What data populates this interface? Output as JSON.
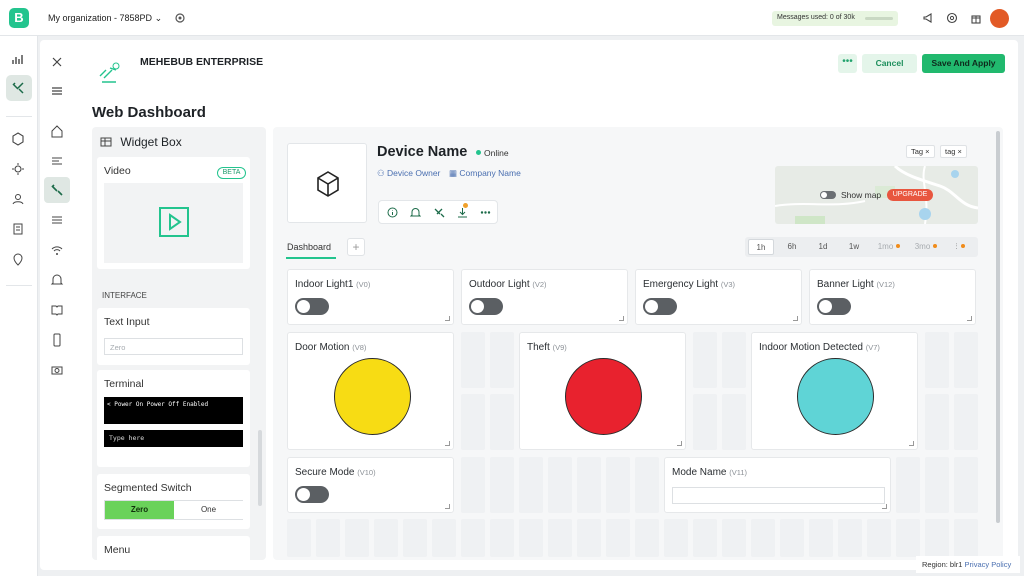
{
  "topbar": {
    "logo": "B",
    "org_name": "My organization - 7858PD",
    "messages": "Messages used: 0 of 30k",
    "icons": [
      "megaphone-icon",
      "globe-icon",
      "gift-icon"
    ],
    "avatar": "avatar"
  },
  "rail": {
    "items": [
      "dashboard-chart-icon",
      "devices-tools-icon",
      "cube-icon",
      "automation-icon",
      "users-icon",
      "organization-icon",
      "location-icon"
    ]
  },
  "header": {
    "device_template": "MEHEBUB ENTERPRISE",
    "more_label": "•••",
    "cancel_label": "Cancel",
    "save_label": "Save And Apply",
    "page_title": "Web Dashboard"
  },
  "widget_box": {
    "title": "Widget Box",
    "video": {
      "label": "Video",
      "badge": "BETA"
    },
    "section_interface": "INTERFACE",
    "text_input": {
      "label": "Text Input",
      "placeholder": "Zero"
    },
    "terminal": {
      "label": "Terminal",
      "output": "< Power On Power Off Enabled",
      "input_placeholder": "Type here"
    },
    "segmented": {
      "label": "Segmented Switch",
      "option_on": "Zero",
      "option_off": "One"
    },
    "menu": {
      "label": "Menu"
    }
  },
  "device": {
    "name": "Device Name",
    "status": "Online",
    "owner": "Device Owner",
    "company": "Company Name",
    "tags": [
      "Tag ×",
      "tag ×"
    ],
    "show_map": "Show map",
    "upgrade": "UPGRADE"
  },
  "tabs": {
    "dashboard": "Dashboard",
    "add": "+"
  },
  "ranges": [
    "1h",
    "6h",
    "1d",
    "1w",
    "1mo",
    "3mo"
  ],
  "widgets": {
    "indoor_light": {
      "title": "Indoor Light1",
      "pin": "(V0)"
    },
    "outdoor_light": {
      "title": "Outdoor Light",
      "pin": "(V2)"
    },
    "emergency_light": {
      "title": "Emergency Light",
      "pin": "(V3)"
    },
    "banner_light": {
      "title": "Banner Light",
      "pin": "(V12)"
    },
    "door_motion": {
      "title": "Door Motion",
      "pin": "(V8)",
      "color": "#f7dc14"
    },
    "theft": {
      "title": "Theft",
      "pin": "(V9)",
      "color": "#e8222e"
    },
    "indoor_motion": {
      "title": "Indoor Motion Detected",
      "pin": "(V7)",
      "color": "#5fd4d6"
    },
    "secure_mode": {
      "title": "Secure Mode",
      "pin": "(V10)"
    },
    "mode_name": {
      "title": "Mode Name",
      "pin": "(V11)"
    }
  },
  "footer": {
    "region": "Region: blr1",
    "privacy": "Privacy Policy"
  }
}
